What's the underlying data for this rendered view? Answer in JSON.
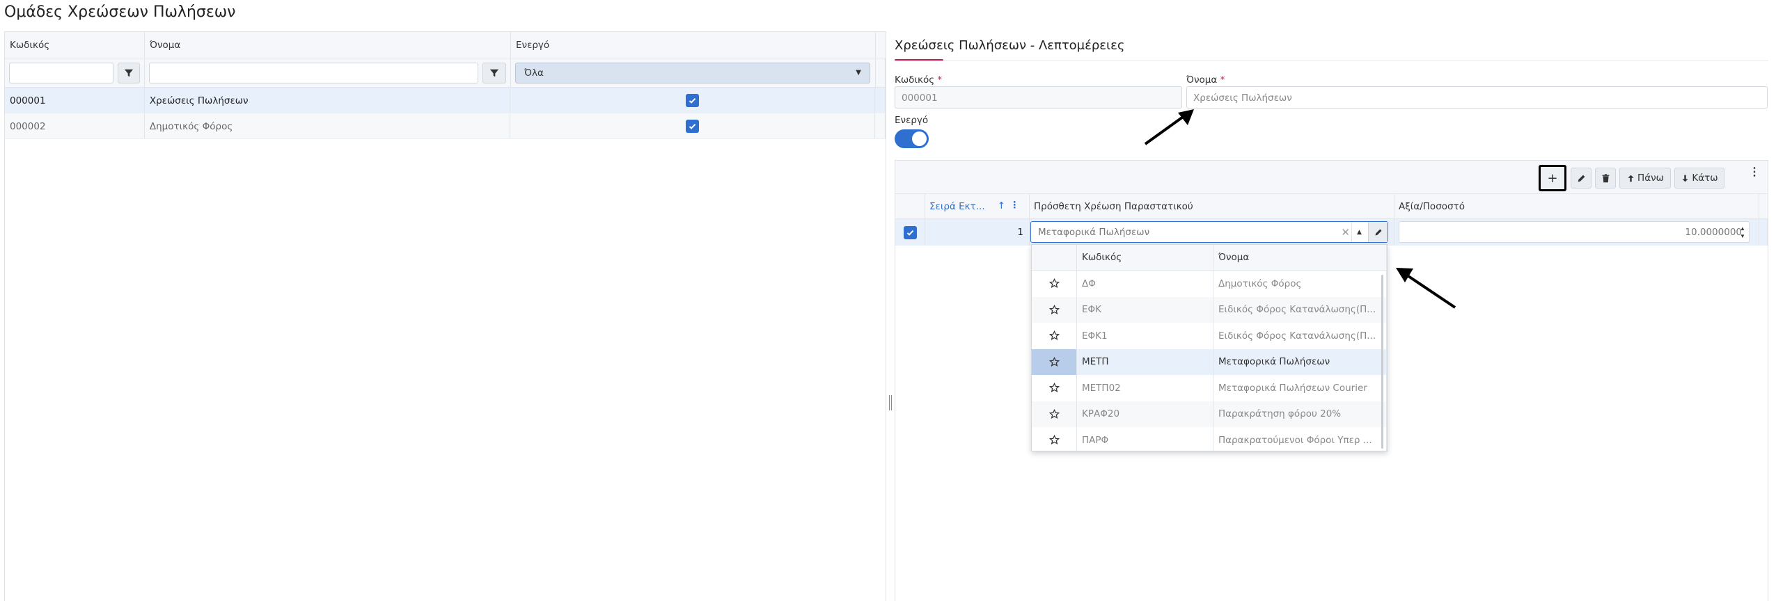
{
  "page": {
    "title": "Ομάδες Χρεώσεων Πωλήσεων"
  },
  "left_grid": {
    "columns": [
      "Κωδικός",
      "Όνομα",
      "Ενεργό"
    ],
    "filter": {
      "active_select_value": "Όλα"
    },
    "rows": [
      {
        "code": "000001",
        "name": "Χρεώσεις Πωλήσεων",
        "active": true
      },
      {
        "code": "000002",
        "name": "Δημοτικός Φόρος",
        "active": true
      }
    ]
  },
  "detail": {
    "title": "Χρεώσεις Πωλήσεων - Λεπτομέρειες",
    "code_label": "Κωδικός",
    "code_value": "000001",
    "name_label": "Όνομα",
    "name_value": "Χρεώσεις Πωλήσεων",
    "required_mark": "*",
    "active_label": "Ενεργό",
    "active_on": true
  },
  "subgrid": {
    "toolbar": {
      "add_label": "+",
      "up_label": "Πάνω",
      "down_label": "Κάτω"
    },
    "columns": [
      "Σειρά Εκτ...",
      "Πρόσθετη Χρέωση Παραστατικού",
      "Αξία/Ποσοστό"
    ],
    "row": {
      "order": "1",
      "charge": "Μεταφορικά Πωλήσεων",
      "value": "10.0000000",
      "checked": true
    }
  },
  "dropdown": {
    "columns": [
      "Κωδικός",
      "Όνομα"
    ],
    "rows": [
      {
        "code": "ΔΦ",
        "name": "Δημοτικός Φόρος"
      },
      {
        "code": "ΕΦΚ",
        "name": "Ειδικός Φόρος Κατανάλωσης(Π..."
      },
      {
        "code": "ΕΦΚ1",
        "name": "Ειδικός Φόρος Κατανάλωσης(Π..."
      },
      {
        "code": "ΜΕΤΠ",
        "name": "Μεταφορικά Πωλήσεων"
      },
      {
        "code": "ΜΕΤΠ02",
        "name": "Μεταφορικά Πωλήσεων Courier"
      },
      {
        "code": "ΚΡΑΦ20",
        "name": "Παρακράτηση φόρου 20%"
      },
      {
        "code": "ΠΑΡΦ",
        "name": "Παρακρατούμενοι Φόροι Υπερ ..."
      }
    ],
    "highlighted_index": 3
  },
  "colors": {
    "accent": "#2f6fd0",
    "underline": "#c21f4e"
  }
}
